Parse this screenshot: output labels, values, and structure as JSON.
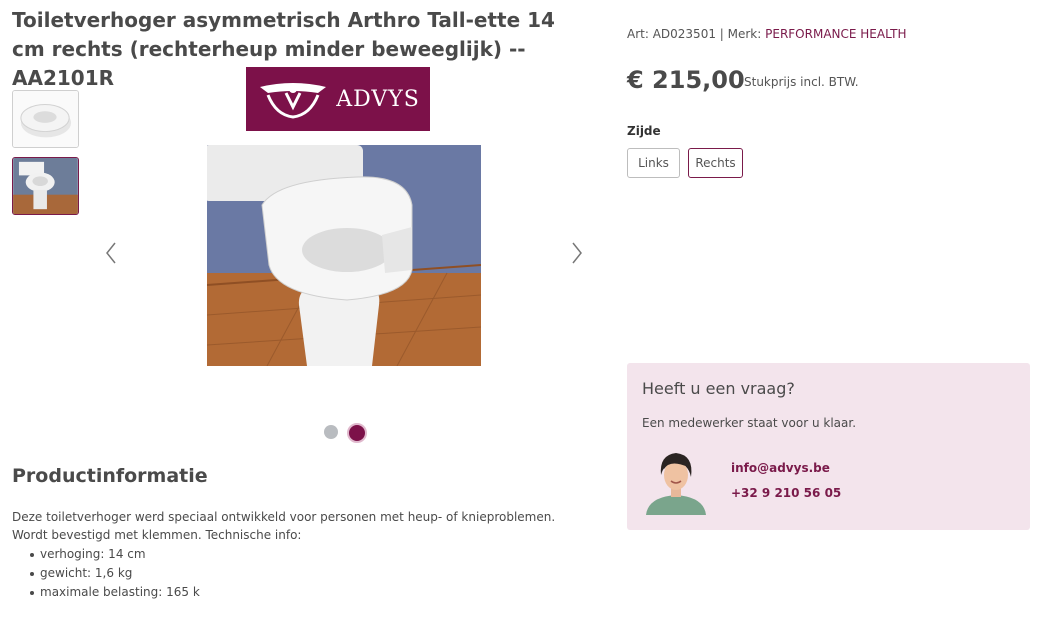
{
  "product": {
    "title": "Toiletverhoger asymmetrisch Arthro Tall-ette 14 cm rechts (rechterheup minder beweeglijk) -- AA2101R",
    "logo_text": "ADVYS",
    "art_label": "Art: AD023501 | Merk: ",
    "brand": "PERFORMANCE HEALTH",
    "price": "€ 215,00",
    "price_note": "Stukprijs incl. BTW.",
    "side_label": "Zijde",
    "options": [
      "Links",
      "Rechts"
    ],
    "selected_option": "Rechts"
  },
  "gallery": {
    "thumbnails": [
      "toilet-seat-riser-thumbnail",
      "toilet-with-riser-thumbnail"
    ],
    "active_index": 1,
    "slide_count": 2
  },
  "info": {
    "heading": "Productinformatie",
    "description": "Deze toiletverhoger werd speciaal ontwikkeld voor personen met heup- of knieproblemen. Wordt bevestigd met klemmen. Technische info:",
    "specs": [
      "verhoging: 14 cm",
      "gewicht: 1,6 kg",
      "maximale belasting: 165 k"
    ]
  },
  "help": {
    "title": "Heeft u een vraag?",
    "subtitle": "Een medewerker staat voor u klaar.",
    "email": "info@advys.be",
    "phone": "+32 9 210 56 05"
  },
  "colors": {
    "brand": "#7c1149",
    "help_bg": "#f3e4ec",
    "text": "#4a4a4a"
  }
}
